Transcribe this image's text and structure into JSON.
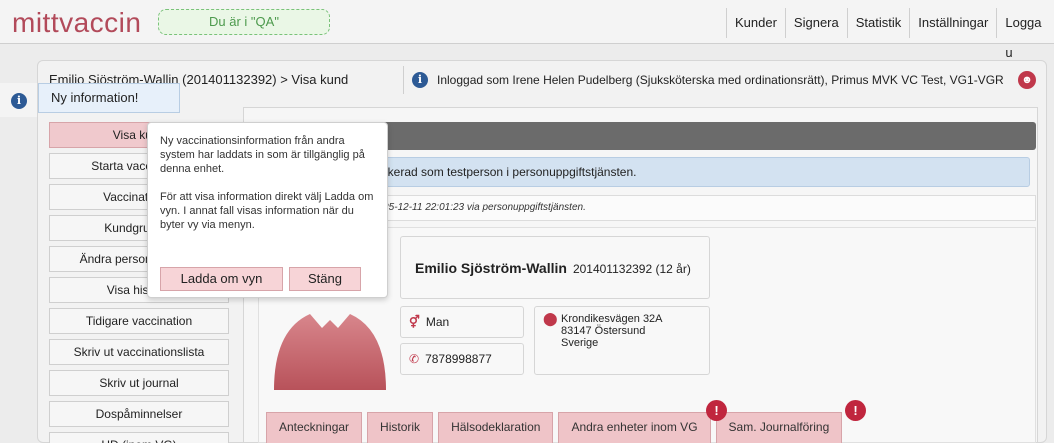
{
  "header": {
    "logo": "mittvaccin",
    "environment_badge": "Du är i \"QA\"",
    "nav": [
      "Kunder",
      "Signera",
      "Statistik",
      "Inställningar",
      "Logga u"
    ]
  },
  "breadcrumb": "Emilio Sjöström-Wallin (201401132392) > Visa kund",
  "login_info": "Inloggad som Irene Helen Pudelberg (Sjuksköterska med ordinationsrätt), Primus MVK VC Test, VG1-VGR",
  "new_info_label": "Ny information!",
  "sidemenu": [
    "Visa kund",
    "Starta vaccination",
    "Vaccinationer",
    "Kundgrupper",
    "Ändra personuppgifter",
    "Visa historik",
    "Tidigare vaccination",
    "Skriv ut vaccinationslista",
    "Skriv ut journal",
    "Dospåminnelser",
    "HD (inom VG)"
  ],
  "popover": {
    "text1": "Ny vaccinationsinformation från andra system har laddats in som är tillgänglig på denna enhet.",
    "text2": "För att visa information direkt välj Ladda om vyn. I annat fall visas information när du byter vy via menyn.",
    "reload_button": "Ladda om vyn",
    "close_button": "Stäng"
  },
  "testperson_text": "arkerad som testperson i personuppgiftstjänsten.",
  "synced_text": "2025-12-11 22:01:23 via personuppgiftstjänsten.",
  "patient": {
    "name": "Emilio Sjöström-Wallin",
    "personnummer_age": "201401132392 (12 år)",
    "sex": "Man",
    "phone": "7878998877",
    "address": [
      "Krondikesvägen 32A",
      "83147 Östersund",
      "Sverige"
    ]
  },
  "tabs": [
    "Anteckningar",
    "Historik",
    "Hälsodeklaration",
    "Andra enheter inom VG",
    "Sam. Journalföring"
  ],
  "alert_symbol": "!",
  "colors": {
    "brand": "#b24a5a",
    "accent_pink": "#efc4c8",
    "info_blue": "#2d5a95",
    "alert_red": "#c0263e"
  }
}
